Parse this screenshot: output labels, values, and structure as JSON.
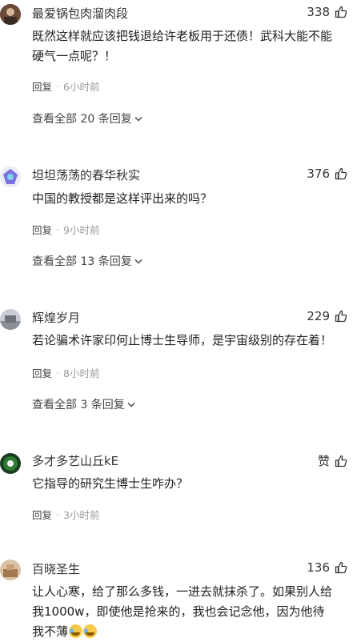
{
  "comments": [
    {
      "username": "最爱锅包肉溜肉段",
      "likes": "338",
      "text": "既然这样就应该把钱退给许老板用于还债！武科大能不能\n硬气一点呢？！",
      "reply": "回复",
      "time": "6小时前",
      "view_all": "查看全部 20 条回复",
      "avatar_color": "#8a6b5a"
    },
    {
      "username": "坦坦荡荡的春华秋实",
      "likes": "376",
      "text": "中国的教授都是这样评出来的吗？",
      "reply": "回复",
      "time": "9小时前",
      "view_all": "查看全部 13 条回复",
      "avatar_color": "#7b6ee0"
    },
    {
      "username": "辉煌岁月",
      "likes": "229",
      "text": "若论骗术许家印何止博士生导师，是宇宙级别的存在着！",
      "reply": "回复",
      "time": "8小时前",
      "view_all": "查看全部 3 条回复",
      "avatar_color": "#9aa0a8"
    },
    {
      "username": "多才多艺山丘kE",
      "likes": "赞",
      "text": "它指导的研究生博士生咋办？",
      "reply": "回复",
      "time": "3小时前",
      "avatar_color": "#2e7d32"
    },
    {
      "username": "百晓圣生",
      "likes": "136",
      "text": "让人心寒，给了那么多钱，一进去就抹杀了。如果别人给\n我1000w，即使他是抢来的，我也会记念他，因为他待\n我不薄",
      "avatar_color": "#c9a27a"
    }
  ],
  "icons": {
    "like": "thumbs-up-icon",
    "expand": "chevron-down-icon",
    "emoji": "crying-laughing-emoji"
  }
}
